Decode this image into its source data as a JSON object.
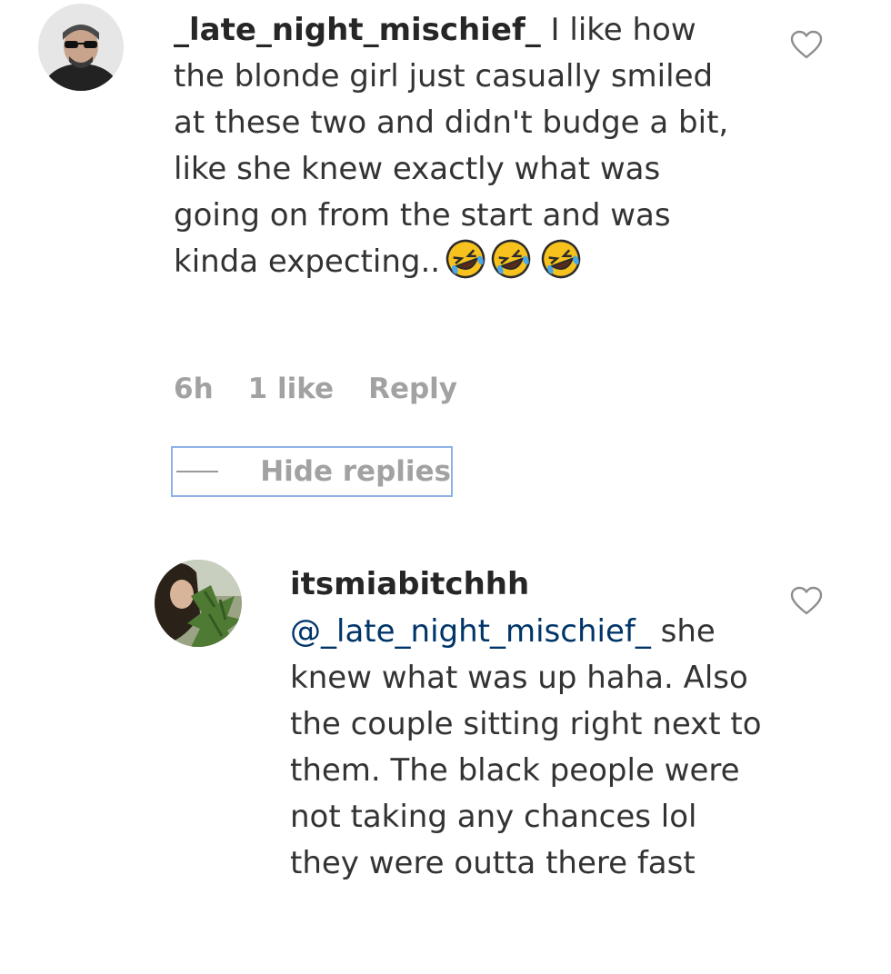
{
  "comment": {
    "username": "_late_night_mischief_",
    "text": " I like how the blonde girl just casually smiled at these two and didn't budge a bit, like she knew exactly what was going on from the start and was kinda expecting..",
    "emojis": [
      "rolling-on-floor-laughing-emoji",
      "rolling-on-floor-laughing-emoji",
      "rolling-on-floor-laughing-emoji"
    ],
    "time": "6h",
    "likes": "1 like",
    "reply_label": "Reply",
    "hide_replies_label": "Hide replies"
  },
  "reply": {
    "username": "itsmiabitchhh",
    "mention": "@_late_night_mischief_",
    "text": " she knew what was up haha. Also the couple sitting right next to them. The black people were not taking any chances lol they were outta there fast"
  },
  "colors": {
    "text": "#262626",
    "meta": "#a2a2a2",
    "mention": "#003569",
    "focus_outline": "#8fb2e6"
  }
}
